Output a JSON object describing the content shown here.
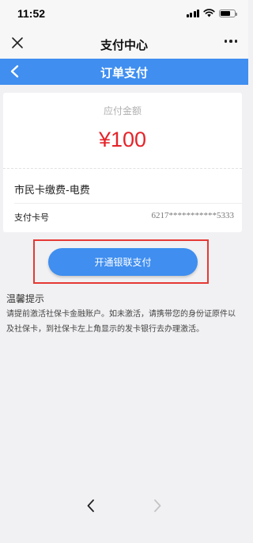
{
  "status_bar": {
    "time": "11:52"
  },
  "title_bar": {
    "title": "支付中心"
  },
  "page_header": {
    "title": "订单支付"
  },
  "order": {
    "amount_label": "应付金额",
    "amount": "¥100",
    "item_name": "市民卡缴费-电费",
    "card_label": "支付卡号",
    "card_number": "6217***********5333"
  },
  "action": {
    "button_label": "开通银联支付"
  },
  "tips": {
    "title": "温馨提示",
    "text": "请提前激活社保卡金融账户。如未激活，请携带您的身份证原件以及社保卡，到社保卡左上角显示的发卡银行去办理激活。"
  },
  "colors": {
    "brand_blue": "#3f8ef0",
    "amount_red": "#e5242a",
    "highlight_red": "#e53935"
  },
  "icons": {
    "close": "close-icon",
    "more": "more-icon",
    "back": "chevron-left-icon",
    "nav_back": "nav-back-icon",
    "nav_forward": "nav-forward-icon"
  }
}
